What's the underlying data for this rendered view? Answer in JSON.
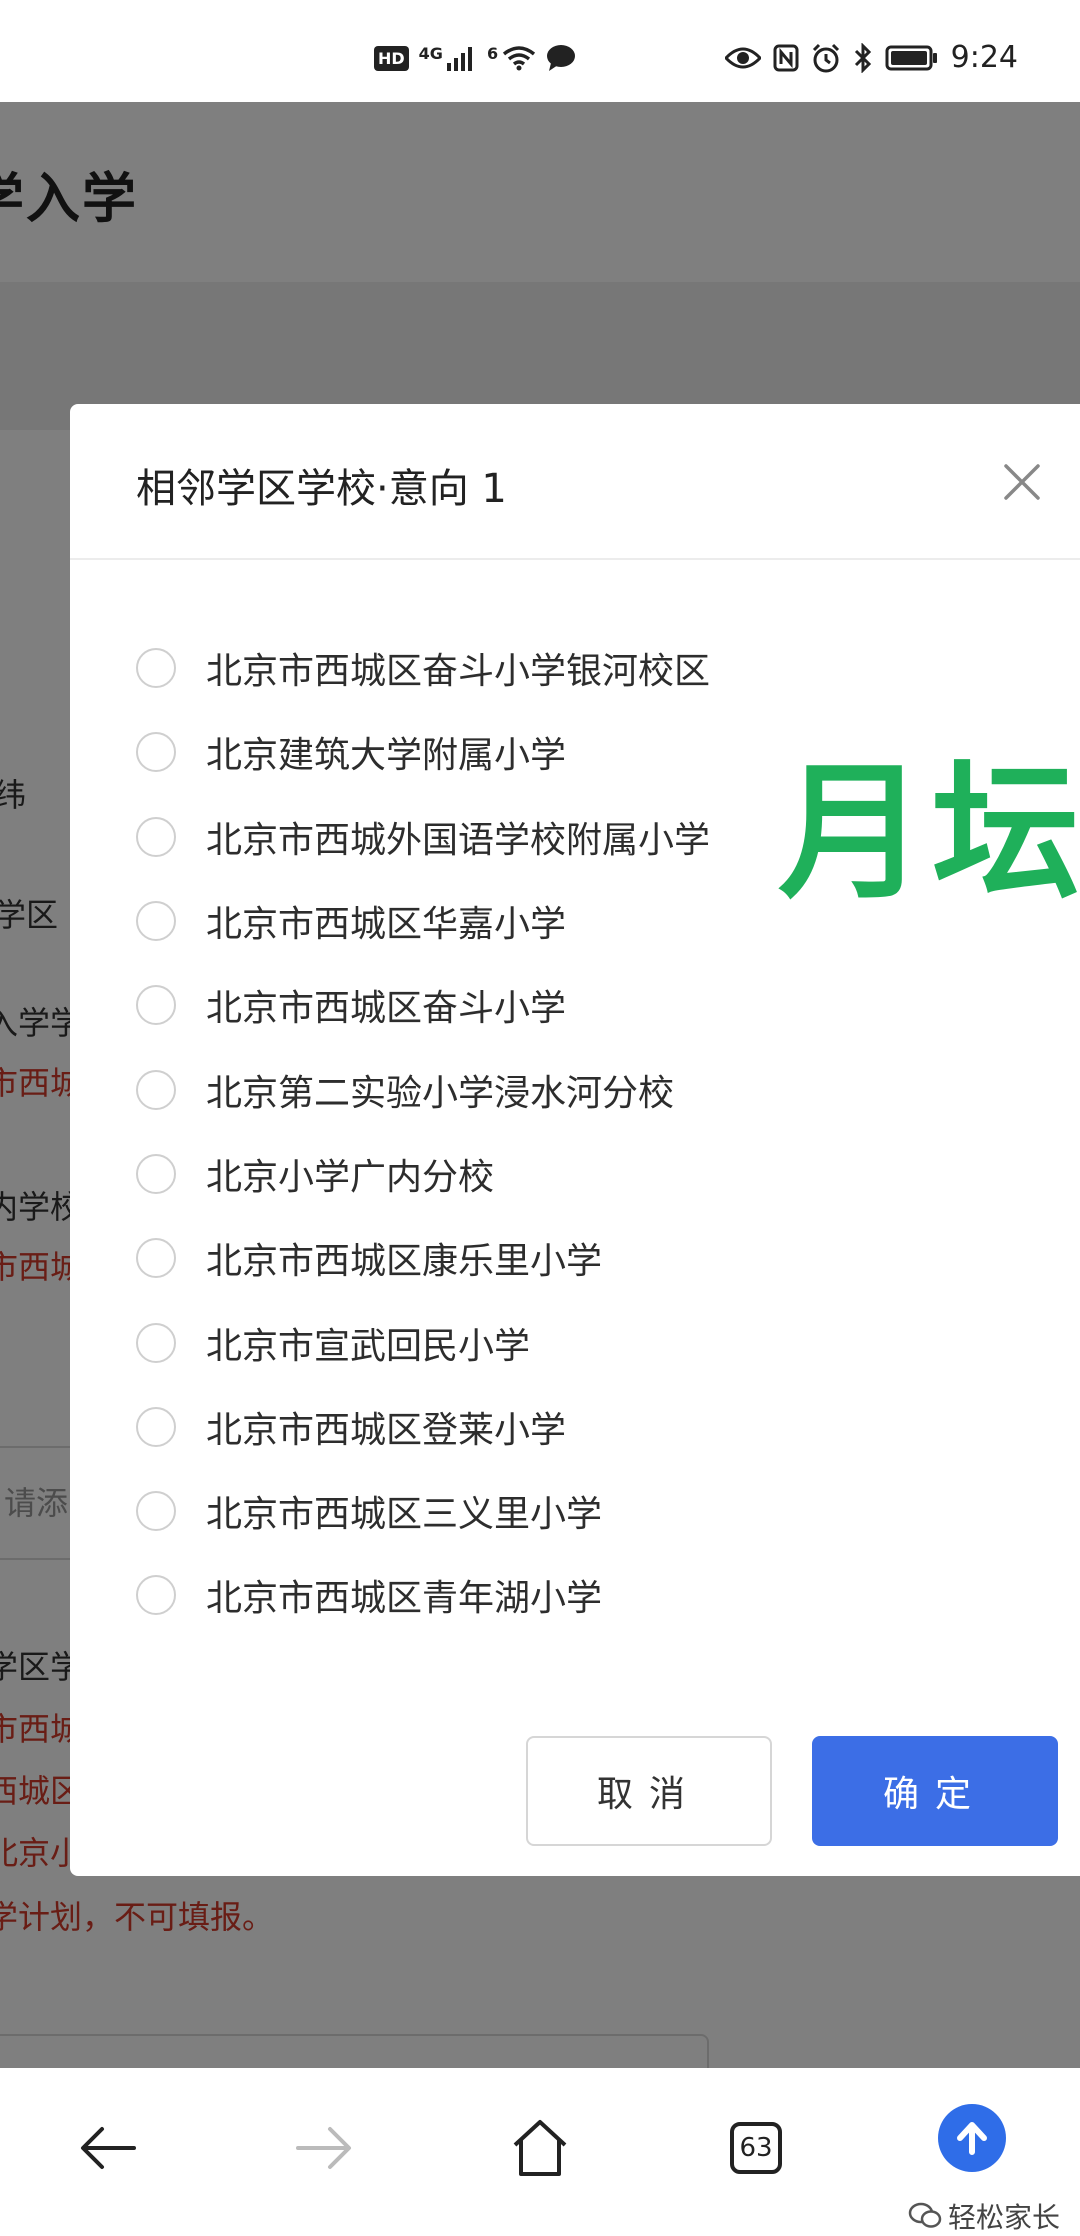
{
  "status_bar": {
    "hd_badge": "HD",
    "signal_4g": "4G",
    "wifi_6": "6",
    "time": "9:24",
    "icons_left": [
      "hd-icon",
      "signal-icon",
      "wifi-icon",
      "message-icon"
    ],
    "icons_right": [
      "eye-icon",
      "nfc-icon",
      "alarm-icon",
      "bluetooth-icon",
      "battery-icon"
    ]
  },
  "background_page": {
    "title": "学入学",
    "fragments": [
      {
        "text": "纬",
        "red": false
      },
      {
        "text": "学区",
        "red": false
      },
      {
        "text": "入学学",
        "red": false
      },
      {
        "text": "市西城",
        "red": true
      },
      {
        "text": "内学校",
        "red": false
      },
      {
        "text": "市西城",
        "red": true
      },
      {
        "text": "请添",
        "red": false
      },
      {
        "text": "学区学",
        "red": false
      },
      {
        "text": "市西城",
        "red": true
      },
      {
        "text": "西城区",
        "red": true
      },
      {
        "text": "北京小",
        "red": true
      },
      {
        "text": "学计划，不可填报。",
        "red": true
      }
    ]
  },
  "modal": {
    "title": "相邻学区学校·意向 1",
    "watermark": "月坛",
    "options": [
      "北京市西城区奋斗小学银河校区",
      "北京建筑大学附属小学",
      "北京市西城外国语学校附属小学",
      "北京市西城区华嘉小学",
      "北京市西城区奋斗小学",
      "北京第二实验小学浸水河分校",
      "北京小学广内分校",
      "北京市西城区康乐里小学",
      "北京市宣武回民小学",
      "北京市西城区登莱小学",
      "北京市西城区三义里小学",
      "北京市西城区青年湖小学"
    ],
    "cancel_label": "取消",
    "confirm_label": "确定"
  },
  "nav_bar": {
    "tabs_count": "63",
    "brand": "轻松家长"
  },
  "colors": {
    "primary": "#3c6ee6",
    "watermark": "#1fb05a",
    "warning": "#d23a2a"
  }
}
